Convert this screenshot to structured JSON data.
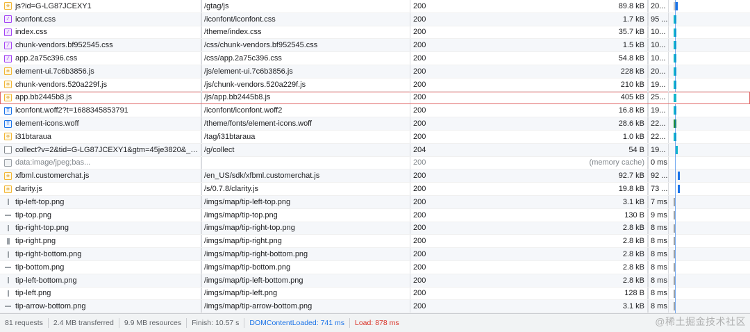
{
  "requests": [
    {
      "name": "js?id=G-LG87JCEXY1",
      "path": "/gtag/js",
      "status": "200",
      "size": "89.8 kB",
      "time": "20...",
      "icon": "js-file-icon",
      "type": "js",
      "wf": [
        970,
        3,
        "#c8c8c8"
      ],
      "wf2": [
        973,
        3,
        "#1a73e8"
      ]
    },
    {
      "name": "iconfont.css",
      "path": "/iconfont/iconfont.css",
      "status": "200",
      "size": "1.7 kB",
      "time": "95 ...",
      "icon": "css-file-icon",
      "type": "css",
      "wf": [
        970,
        4,
        "#12b5cb"
      ]
    },
    {
      "name": "index.css",
      "path": "/theme/index.css",
      "status": "200",
      "size": "35.7 kB",
      "time": "10...",
      "icon": "css-file-icon",
      "type": "css",
      "wf": [
        970,
        4,
        "#12b5cb"
      ]
    },
    {
      "name": "chunk-vendors.bf952545.css",
      "path": "/css/chunk-vendors.bf952545.css",
      "status": "200",
      "size": "1.5 kB",
      "time": "10...",
      "icon": "css-file-icon",
      "type": "css",
      "wf": [
        970,
        4,
        "#12b5cb"
      ]
    },
    {
      "name": "app.2a75c396.css",
      "path": "/css/app.2a75c396.css",
      "status": "200",
      "size": "54.8 kB",
      "time": "10...",
      "icon": "css-file-icon",
      "type": "css",
      "wf": [
        970,
        4,
        "#12b5cb"
      ]
    },
    {
      "name": "element-ui.7c6b3856.js",
      "path": "/js/element-ui.7c6b3856.js",
      "status": "200",
      "size": "228 kB",
      "time": "20...",
      "icon": "js-file-icon",
      "type": "js",
      "wf": [
        970,
        4,
        "#12b5cb"
      ]
    },
    {
      "name": "chunk-vendors.520a229f.js",
      "path": "/js/chunk-vendors.520a229f.js",
      "status": "200",
      "size": "210 kB",
      "time": "19...",
      "icon": "js-file-icon",
      "type": "js",
      "wf": [
        970,
        4,
        "#12b5cb"
      ]
    },
    {
      "name": "app.bb2445b8.js",
      "path": "/js/app.bb2445b8.js",
      "status": "200",
      "size": "405 kB",
      "time": "25...",
      "icon": "js-file-icon",
      "type": "js",
      "selected": true,
      "wf": [
        970,
        4,
        "#12b5cb"
      ]
    },
    {
      "name": "iconfont.woff2?t=1688345853791",
      "path": "/iconfont/iconfont.woff2",
      "status": "200",
      "size": "16.8 kB",
      "time": "19...",
      "icon": "font-file-icon",
      "type": "font",
      "wf": [
        970,
        4,
        "#12b5cb"
      ]
    },
    {
      "name": "element-icons.woff",
      "path": "/theme/fonts/element-icons.woff",
      "status": "200",
      "size": "28.6 kB",
      "time": "22...",
      "icon": "font-file-icon",
      "type": "font",
      "wf": [
        970,
        4,
        "#1e8e3e"
      ]
    },
    {
      "name": "i31btaraua",
      "path": "/tag/i31btaraua",
      "status": "200",
      "size": "1.0 kB",
      "time": "22...",
      "icon": "js-file-icon",
      "type": "js",
      "wf": [
        970,
        4,
        "#12b5cb"
      ]
    },
    {
      "name": "collect?v=2&tid=G-LG87JCEXY1&gtm=45je3820&_p...",
      "path": "/g/collect",
      "status": "204",
      "size": "54 B",
      "time": "19...",
      "icon": "document-icon",
      "type": "doc",
      "wf": [
        973,
        3,
        "#12b5cb"
      ]
    },
    {
      "name": "data:image/jpeg;bas...",
      "path": "",
      "status": "200",
      "size": "(memory cache)",
      "time": "0 ms",
      "icon": "image-file-icon",
      "type": "photo",
      "dim": true
    },
    {
      "name": "xfbml.customerchat.js",
      "path": "/en_US/sdk/xfbml.customerchat.js",
      "status": "200",
      "size": "92.7 kB",
      "time": "92 ...",
      "icon": "js-file-icon",
      "type": "js",
      "wf": [
        976,
        3,
        "#1a73e8"
      ]
    },
    {
      "name": "clarity.js",
      "path": "/s/0.7.8/clarity.js",
      "status": "200",
      "size": "19.8 kB",
      "time": "73 ...",
      "icon": "js-file-icon",
      "type": "js",
      "wf": [
        976,
        3,
        "#1a73e8"
      ]
    },
    {
      "name": "tip-left-top.png",
      "path": "/imgs/map/tip-left-top.png",
      "status": "200",
      "size": "3.1 kB",
      "time": "7 ms",
      "icon": "image-file-icon",
      "type": "img",
      "wf": [
        970,
        2,
        "#9aa0a6"
      ]
    },
    {
      "name": "tip-top.png",
      "path": "/imgs/map/tip-top.png",
      "status": "200",
      "size": "130 B",
      "time": "9 ms",
      "icon": "image-file-icon",
      "type": "img",
      "wf": [
        970,
        2,
        "#9aa0a6"
      ]
    },
    {
      "name": "tip-right-top.png",
      "path": "/imgs/map/tip-right-top.png",
      "status": "200",
      "size": "2.8 kB",
      "time": "8 ms",
      "icon": "image-file-icon",
      "type": "img",
      "wf": [
        970,
        2,
        "#9aa0a6"
      ]
    },
    {
      "name": "tip-right.png",
      "path": "/imgs/map/tip-right.png",
      "status": "200",
      "size": "2.8 kB",
      "time": "8 ms",
      "icon": "image-file-icon",
      "type": "img",
      "wf": [
        970,
        2,
        "#9aa0a6"
      ]
    },
    {
      "name": "tip-right-bottom.png",
      "path": "/imgs/map/tip-right-bottom.png",
      "status": "200",
      "size": "2.8 kB",
      "time": "8 ms",
      "icon": "image-file-icon",
      "type": "img",
      "wf": [
        970,
        2,
        "#9aa0a6"
      ]
    },
    {
      "name": "tip-bottom.png",
      "path": "/imgs/map/tip-bottom.png",
      "status": "200",
      "size": "2.8 kB",
      "time": "8 ms",
      "icon": "image-file-icon",
      "type": "img",
      "wf": [
        970,
        2,
        "#9aa0a6"
      ]
    },
    {
      "name": "tip-left-bottom.png",
      "path": "/imgs/map/tip-left-bottom.png",
      "status": "200",
      "size": "2.8 kB",
      "time": "8 ms",
      "icon": "image-file-icon",
      "type": "img",
      "wf": [
        970,
        2,
        "#9aa0a6"
      ]
    },
    {
      "name": "tip-left.png",
      "path": "/imgs/map/tip-left.png",
      "status": "200",
      "size": "128 B",
      "time": "8 ms",
      "icon": "image-file-icon",
      "type": "img",
      "wf": [
        970,
        2,
        "#9aa0a6"
      ]
    },
    {
      "name": "tip-arrow-bottom.png",
      "path": "/imgs/map/tip-arrow-bottom.png",
      "status": "200",
      "size": "3.1 kB",
      "time": "8 ms",
      "icon": "image-file-icon",
      "type": "img",
      "wf": [
        970,
        2,
        "#9aa0a6"
      ]
    }
  ],
  "summary": {
    "requests": "81 requests",
    "transferred": "2.4 MB transferred",
    "resources": "9.9 MB resources",
    "finish": "Finish: 10.57 s",
    "dom_content_loaded": "DOMContentLoaded: 741 ms",
    "load": "Load: 878 ms"
  },
  "watermark": "@稀土掘金技术社区",
  "colors": {
    "selected_outline": "#e06666",
    "dom_content_loaded": "#1a73e8",
    "load": "#d93025"
  }
}
